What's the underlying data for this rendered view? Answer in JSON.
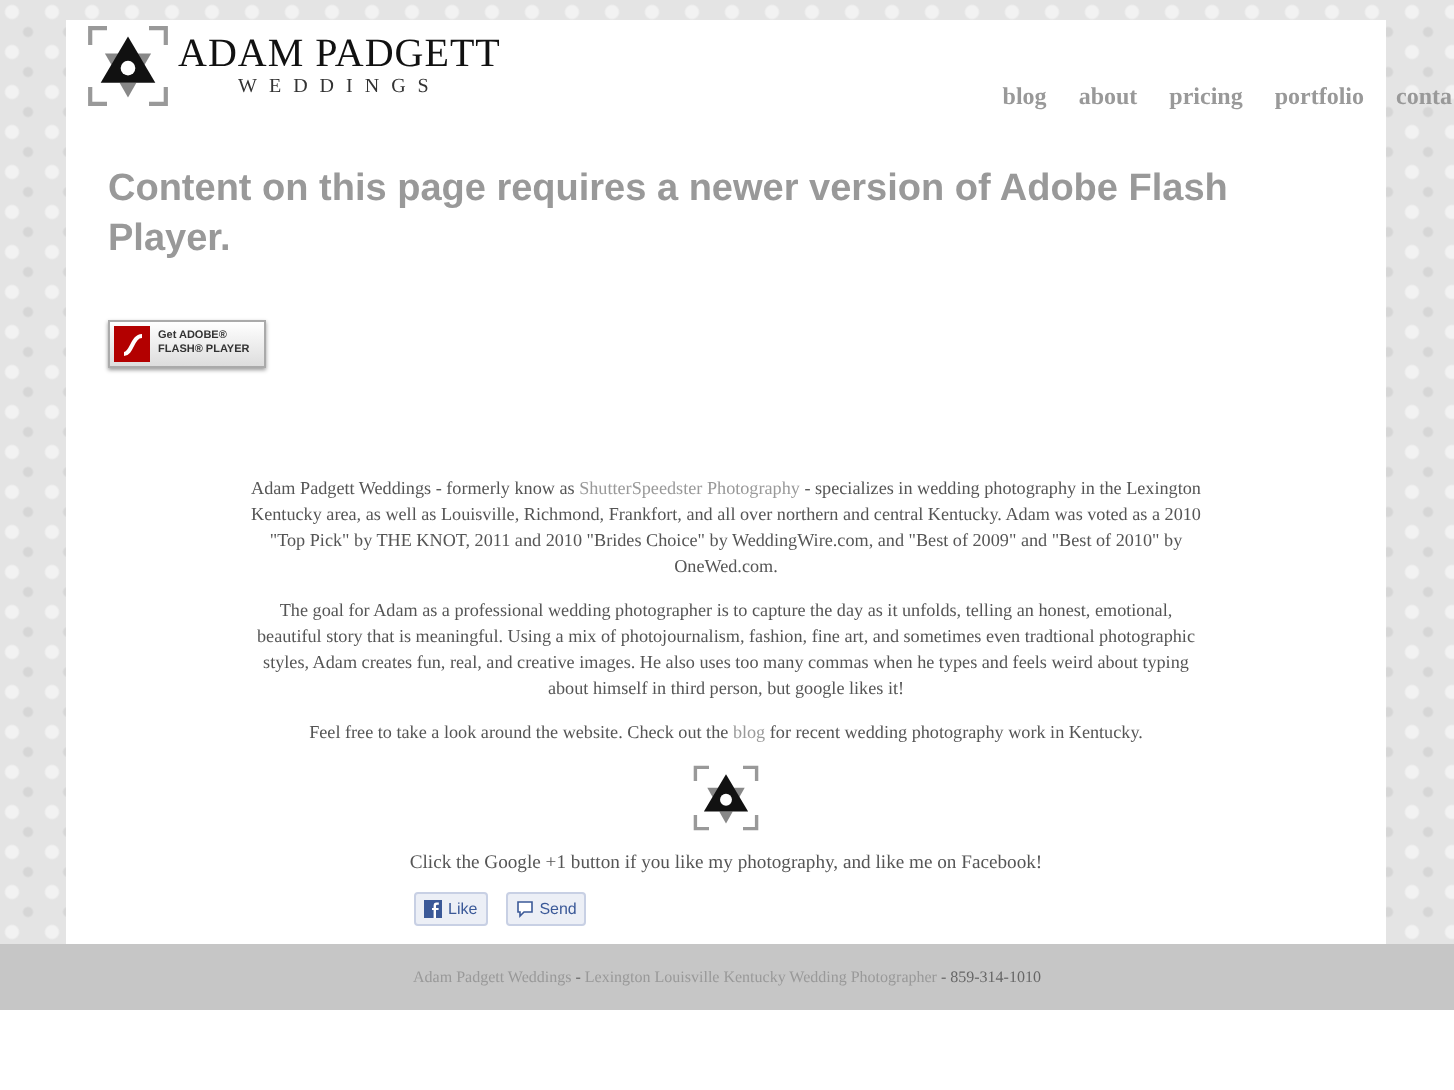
{
  "header": {
    "brand": "ADAM PADGETT",
    "tagline": "WEDDINGS"
  },
  "nav": [
    "blog",
    "about",
    "pricing",
    "portfolio",
    "conta"
  ],
  "flash_notice": {
    "heading": "Content on this page requires a newer version of Adobe Flash Player.",
    "badge_line_1": "Get ADOBE®",
    "badge_line_2": "FLASH® PLAYER"
  },
  "paragraphs": [
    {
      "parts": [
        {
          "text": "Adam Padgett Weddings - formerly know as ",
          "link": false
        },
        {
          "text": "ShutterSpeedster Photography",
          "link": true
        },
        {
          "text": " - specializes in wedding photography in the Lexington Kentucky area, as well as Louisville, Richmond, Frankfort, and all over northern and central Kentucky. Adam was voted as a 2010 \"Top Pick\" by THE KNOT, 2011 and 2010 \"Brides Choice\" by WeddingWire.com, and \"Best of 2009\" and \"Best of 2010\" by OneWed.com.",
          "link": false
        }
      ]
    },
    {
      "parts": [
        {
          "text": "The goal for Adam as a professional wedding photographer is to capture the day as it unfolds, telling an honest, emotional, beautiful story that is meaningful. Using a mix of photojournalism, fashion, fine art, and sometimes even tradtional photographic styles, Adam creates fun, real, and creative images. He also uses too many commas when he types and feels weird about typing about himself in third person, but google likes it!",
          "link": false
        }
      ]
    },
    {
      "parts": [
        {
          "text": "Feel free to take a look around the website. Check out the ",
          "link": false
        },
        {
          "text": "blog",
          "link": true
        },
        {
          "text": " for recent wedding photography work in Kentucky.",
          "link": false
        }
      ]
    }
  ],
  "social_prompt": "Click the Google +1 button if you like my photography, and like me on Facebook!",
  "social_buttons": [
    {
      "kind": "like",
      "label": "Like"
    },
    {
      "kind": "send",
      "label": "Send"
    }
  ],
  "footer": {
    "parts": [
      {
        "text": "Adam Padgett Weddings",
        "link": true
      },
      {
        "text": " - ",
        "link": false
      },
      {
        "text": "Lexington Louisville Kentucky Wedding Photographer",
        "link": true
      },
      {
        "text": " - 859-314-1010",
        "link": false
      }
    ]
  }
}
